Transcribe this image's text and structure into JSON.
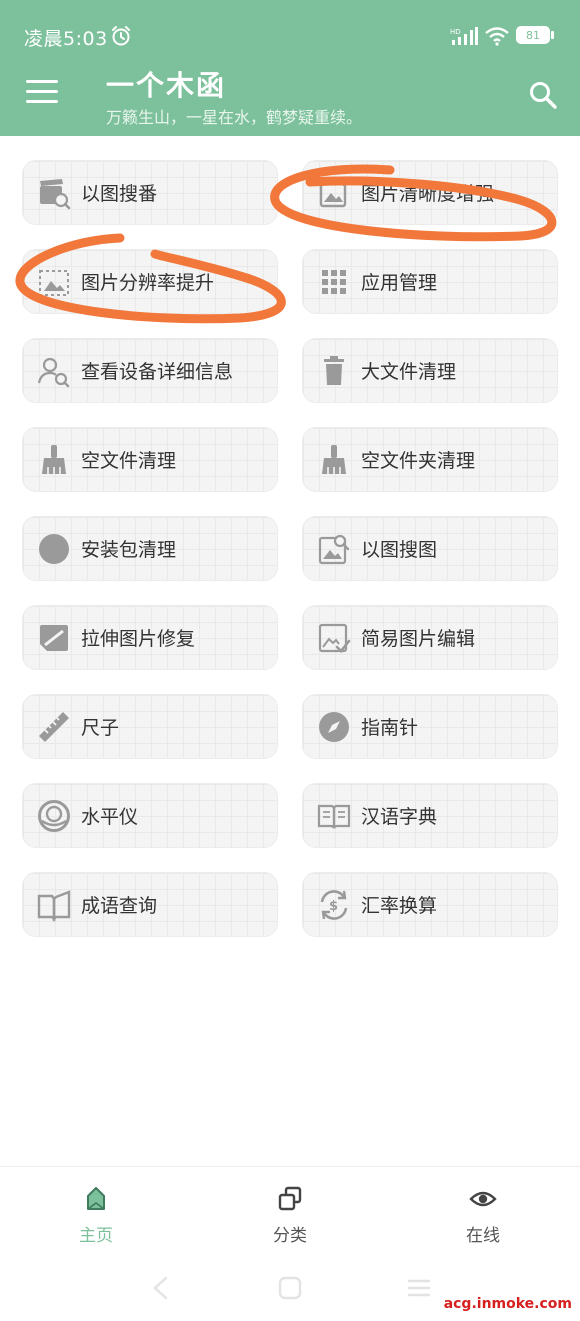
{
  "status": {
    "time": "凌晨5:03",
    "battery": "81"
  },
  "header": {
    "title": "一个木函",
    "subtitle": "万籁生山，一星在水，鹤梦疑重续。"
  },
  "tools": [
    {
      "label": "以图搜番",
      "icon": "clapperboard-search-icon"
    },
    {
      "label": "图片清晰度增强",
      "icon": "image-enhance-icon"
    },
    {
      "label": "图片分辨率提升",
      "icon": "image-resolution-icon"
    },
    {
      "label": "应用管理",
      "icon": "grid-apps-icon"
    },
    {
      "label": "查看设备详细信息",
      "icon": "user-search-icon"
    },
    {
      "label": "大文件清理",
      "icon": "trash-icon"
    },
    {
      "label": "空文件清理",
      "icon": "broom-icon"
    },
    {
      "label": "空文件夹清理",
      "icon": "broom-icon"
    },
    {
      "label": "安装包清理",
      "icon": "circle-icon"
    },
    {
      "label": "以图搜图",
      "icon": "image-search-icon"
    },
    {
      "label": "拉伸图片修复",
      "icon": "image-stretch-icon"
    },
    {
      "label": "简易图片编辑",
      "icon": "image-edit-icon"
    },
    {
      "label": "尺子",
      "icon": "ruler-icon"
    },
    {
      "label": "指南针",
      "icon": "compass-icon"
    },
    {
      "label": "水平仪",
      "icon": "level-icon"
    },
    {
      "label": "汉语字典",
      "icon": "book-icon"
    },
    {
      "label": "成语查询",
      "icon": "open-book-icon"
    },
    {
      "label": "汇率换算",
      "icon": "currency-exchange-icon"
    }
  ],
  "nav": [
    {
      "label": "主页",
      "icon": "home-icon",
      "active": true
    },
    {
      "label": "分类",
      "icon": "category-icon",
      "active": false
    },
    {
      "label": "在线",
      "icon": "eye-icon",
      "active": false
    }
  ],
  "watermark": "acg.inmoke.com",
  "colors": {
    "accent": "#7dc19c",
    "scribble": "#f2773a",
    "icon": "#9a9a9a"
  }
}
